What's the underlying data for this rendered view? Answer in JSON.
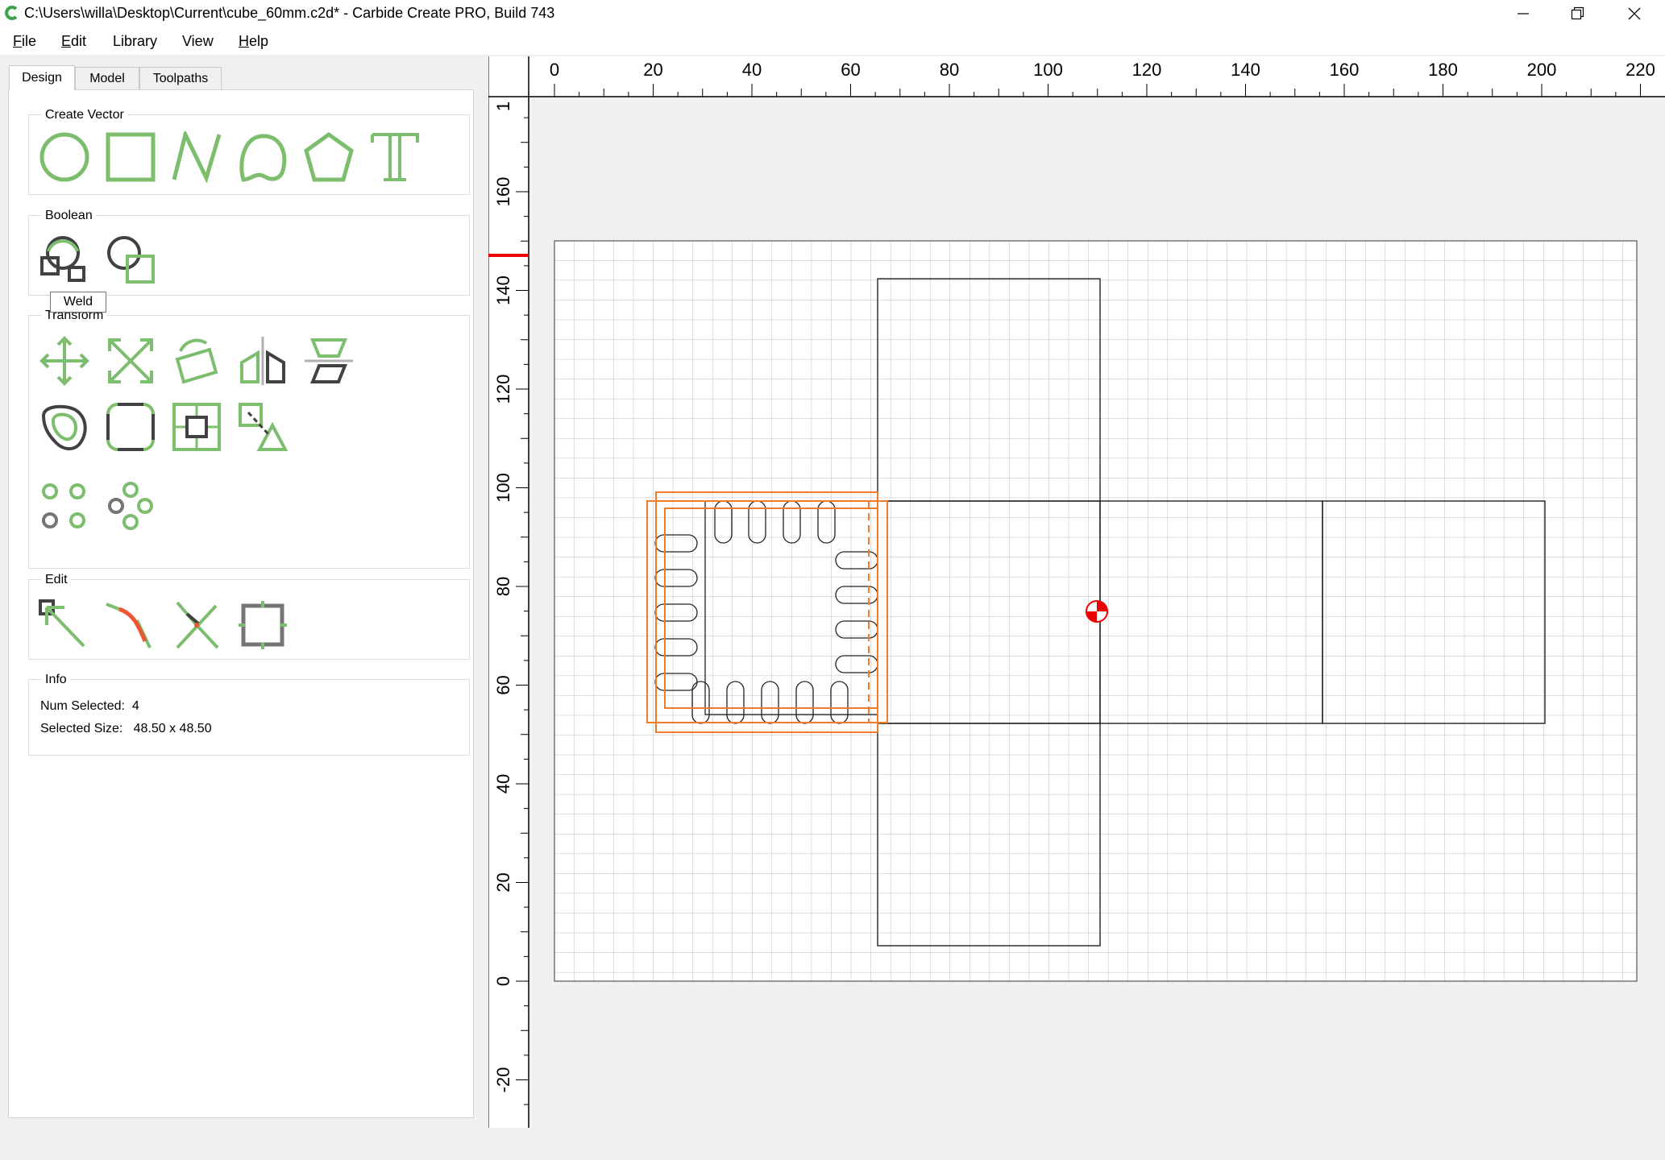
{
  "window": {
    "title": "C:\\Users\\willa\\Desktop\\Current\\cube_60mm.c2d* - Carbide Create PRO, Build 743",
    "controls": [
      "minimize-icon",
      "restore-icon",
      "close-icon"
    ]
  },
  "menubar": {
    "items": [
      {
        "label": "File",
        "hotkey": "F",
        "rest": "ile"
      },
      {
        "label": "Edit",
        "hotkey": "E",
        "rest": "dit"
      },
      {
        "label": "Library"
      },
      {
        "label": "View"
      },
      {
        "label": "Help",
        "hotkey": "H",
        "rest": "elp"
      }
    ]
  },
  "tabs": [
    {
      "label": "Design",
      "active": true
    },
    {
      "label": "Model",
      "active": false
    },
    {
      "label": "Toolpaths",
      "active": false
    }
  ],
  "groups": {
    "create_vector": {
      "title": "Create Vector",
      "tools": [
        "circle-icon",
        "rectangle-icon",
        "polyline-icon",
        "curve-icon",
        "polygon-icon",
        "text-icon"
      ]
    },
    "boolean": {
      "title": "Boolean",
      "tools": [
        "weld-icon",
        "subtract-icon"
      ]
    },
    "transform": {
      "title": "Transform",
      "tools": [
        "move-icon",
        "scale-icon",
        "rotate-icon",
        "mirror-icon",
        "flip-icon",
        "offset-icon",
        "fillet-icon",
        "align-icon",
        "align-to-shape-icon",
        "array-icon",
        "circular-array-icon"
      ]
    },
    "edit": {
      "title": "Edit",
      "tools": [
        "edit-nodes-icon",
        "fillet-path-icon",
        "trim-icon",
        "bounding-box-icon"
      ]
    },
    "info": {
      "title": "Info",
      "num_selected_label": "Num Selected:",
      "num_selected": "4",
      "selected_size_label": "Selected Size:",
      "selected_size": "48.50 x 48.50"
    }
  },
  "tooltip": "Weld",
  "ruler": {
    "x_labels": [
      "0",
      "20",
      "40",
      "60",
      "80",
      "100",
      "120",
      "140",
      "160",
      "180",
      "200",
      "220"
    ],
    "y_labels": [
      "160",
      "140",
      "120",
      "100",
      "80",
      "60",
      "40",
      "20",
      "0",
      "-20"
    ]
  },
  "colors": {
    "accent_green": "#7dbe6e",
    "dark_gray": "#414143",
    "selection_orange": "#f07c2a",
    "origin_red": "#ee0000"
  }
}
